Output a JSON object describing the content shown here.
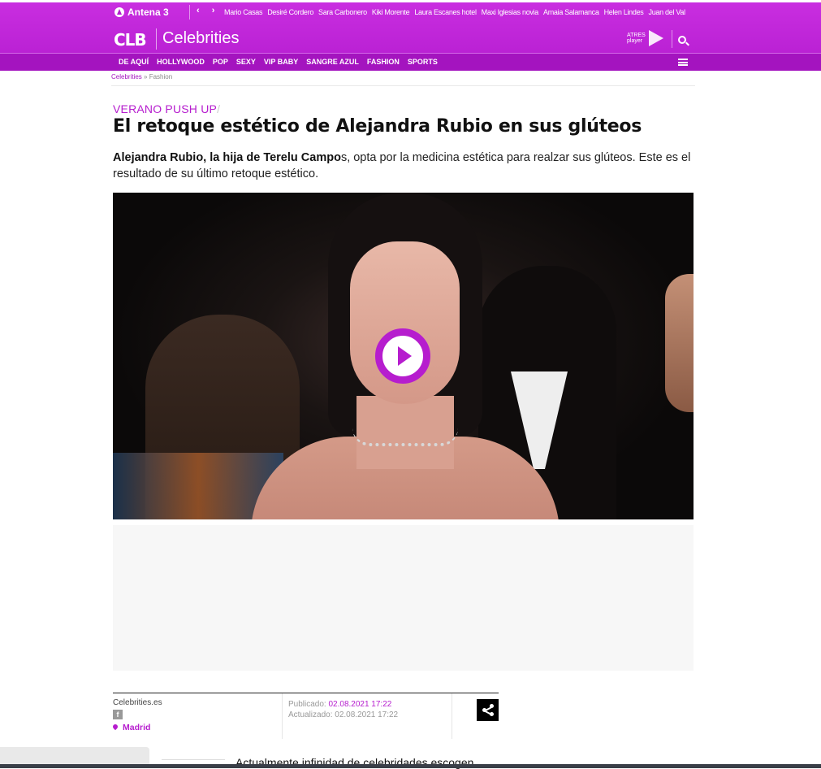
{
  "header": {
    "network_logo": "Antena 3",
    "nav_arrows": "‹ ›",
    "trending": [
      "Mario Casas",
      "Desiré Cordero",
      "Sara Carbonero",
      "Kiki Morente",
      "Laura Escanes hotel",
      "Maxi Iglesias novia",
      "Amaia Salamanca",
      "Helen Lindes",
      "Juan del Val"
    ],
    "site_logo": "CLB",
    "site_title": "Celebrities",
    "player_logo_line1": "ATRES",
    "player_logo_line2": "player",
    "sections": [
      "DE AQUÍ",
      "HOLLYWOOD",
      "POP",
      "SEXY",
      "VIP BABY",
      "SANGRE AZUL",
      "FASHION",
      "SPORTS"
    ]
  },
  "breadcrumb": {
    "root": "Celebrities",
    "separator": "»",
    "current": "Fashion"
  },
  "article": {
    "kicker": "VERANO PUSH UP",
    "kicker_sep": "/",
    "headline": "El retoque estético de Alejandra Rubio en sus glúteos",
    "subhead_bold": "Alejandra Rubio, la hija de Terelu Campo",
    "subhead_rest": "s, opta por la medicina estética para realzar sus glúteos. Este es el resultado de su último retoque estético.",
    "body_start": "Actualmente infinidad de celebridades escogen"
  },
  "byline": {
    "source": "Celebrities.es",
    "facebook_glyph": "f",
    "location": "Madrid",
    "published_label": "Publicado:",
    "published_value": "02.08.2021 17:22",
    "updated_label": "Actualizado:",
    "updated_value": "02.08.2021 17:22"
  },
  "colors": {
    "brand": "#b61dce",
    "header_bg": "#c22ad9",
    "section_bar": "#a414bf"
  },
  "icons": [
    "antena3-icon",
    "search-icon",
    "menu-icon",
    "play-icon",
    "facebook-icon",
    "pin-icon",
    "share-icon"
  ]
}
